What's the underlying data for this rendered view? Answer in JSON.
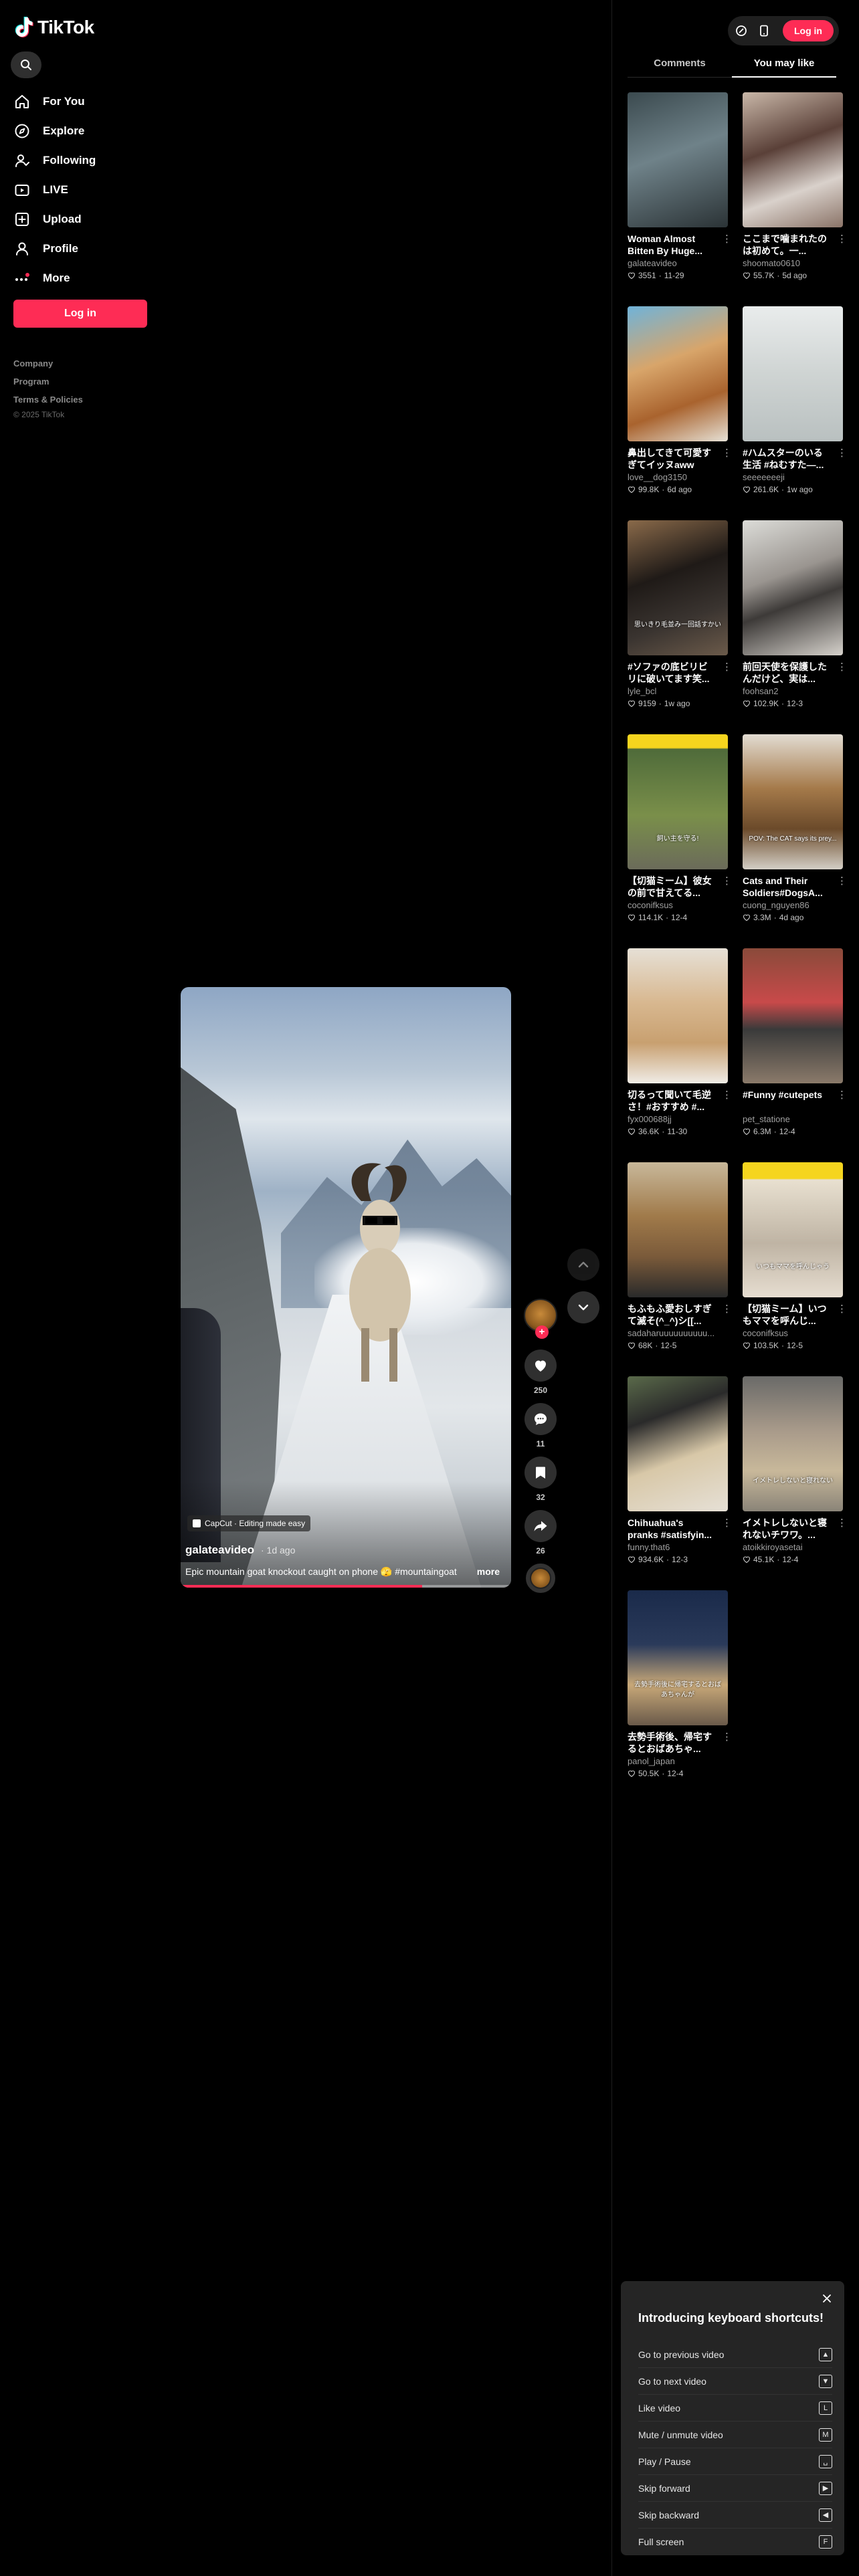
{
  "brand": {
    "name": "TikTok",
    "accent": "#fe2c55"
  },
  "sidebar": {
    "nav": [
      {
        "label": "For You",
        "icon": "home-icon"
      },
      {
        "label": "Explore",
        "icon": "compass-icon"
      },
      {
        "label": "Following",
        "icon": "following-icon"
      },
      {
        "label": "LIVE",
        "icon": "live-icon"
      },
      {
        "label": "Upload",
        "icon": "upload-icon"
      },
      {
        "label": "Profile",
        "icon": "profile-icon"
      },
      {
        "label": "More",
        "icon": "more-icon"
      }
    ],
    "login_label": "Log in",
    "footer": [
      "Company",
      "Program",
      "Terms & Policies"
    ],
    "copyright": "© 2025 TikTok"
  },
  "video": {
    "badge": "CapCut · Editing made easy",
    "author": "galateavideo",
    "posted": "· 1d ago",
    "caption": "Epic mountain goat knockout caught on phone 🫣 #mountaingoat",
    "more_label": "more",
    "progress": 0.73
  },
  "actions": {
    "likes": "250",
    "comments": "11",
    "saves": "32",
    "shares": "26"
  },
  "header": {
    "login_label": "Log in"
  },
  "tabs": [
    {
      "label": "Comments",
      "active": false
    },
    {
      "label": "You may like",
      "active": true
    }
  ],
  "recommended": [
    {
      "title": "Woman Almost Bitten By Huge...",
      "author": "galateavideo",
      "views": "3551",
      "date": "11-29",
      "bg": "linear-gradient(160deg,#3b4a4f,#6f8289 45%,#2b3336)"
    },
    {
      "title": "ここまで噛まれたのは初めて。一...",
      "author": "shoomato0610",
      "views": "55.7K",
      "date": "5d ago",
      "bg": "linear-gradient(160deg,#c9b7a8,#5a4038 40%,#d9d1cb 70%,#8b7468)"
    },
    {
      "title": "鼻出してきて可愛すぎてイッヌaww",
      "author": "love__dog3150",
      "views": "99.8K",
      "date": "6d ago",
      "bg": "linear-gradient(160deg,#6fb3d9,#d8a56a 40%,#a9632e 70%,#e6e1d6)"
    },
    {
      "title": "#ハムスターのいる生活 #ねむすた—...",
      "author": "seeeeeeeji",
      "views": "261.6K",
      "date": "1w ago",
      "bg": "linear-gradient(180deg,#e9ecec,#cfd4d3 50%,#b9c0c0)"
    },
    {
      "title": "#ソファの底ビリビリに破いてます笑...",
      "author": "lyle_bcl",
      "views": "9159",
      "date": "1w ago",
      "overlay": "思いきり毛並み一回話すかい",
      "bg": "linear-gradient(160deg,#8a6a4a,#1f1a17 40%,#3a3430 70%,#6b5a4a)"
    },
    {
      "title": "前回天使を保護したんだけど、実は...",
      "author": "foohsan2",
      "views": "102.9K",
      "date": "12-3",
      "bg": "linear-gradient(160deg,#dcdcd8,#9a9590 40%,#3d3a38 60%,#d6d2cc)"
    },
    {
      "title": "【切猫ミーム】彼女の前で甘えてる...",
      "author": "coconifksus",
      "views": "114.1K",
      "date": "12-4",
      "overlay": "飼い主を守る!",
      "bg": "linear-gradient(180deg,#f5d51e 0%,#f5d51e 10%,#4f6b3a 11%,#7a8f4a 60%,#6b6b5a)"
    },
    {
      "title": "Cats and Their Soldiers#DogsA...",
      "author": "cuong_nguyen86",
      "views": "3.3M",
      "date": "4d ago",
      "overlay": "POV: The CAT says its prey...",
      "bg": "linear-gradient(180deg,#e2dcd2,#a57a4a 40%,#6b4a2a 70%,#d4cfc6)"
    },
    {
      "title": "切るって聞いて毛逆さ！#おすすめ #...",
      "author": "fyx000688jj",
      "views": "36.6K",
      "date": "11-30",
      "bg": "linear-gradient(180deg,#e6e0d6,#d8b890 40%,#c8a070 70%,#f0ece6)"
    },
    {
      "title": "#Funny #cutepets",
      "author": "pet_statione",
      "views": "6.3M",
      "date": "12-4",
      "bg": "linear-gradient(180deg,#8a4a3a,#c84a4a 40%,#3a3a3a 60%,#8a7a6a)"
    },
    {
      "title": "もふもふ愛おしすぎて滅そ(^_^)シ[[...",
      "author": "sadaharuuuuuuuuuu...",
      "views": "68K",
      "date": "12-5",
      "bg": "linear-gradient(180deg,#c8b89a,#a07a4a 40%,#7a5a3a 70%,#2a2a2a)"
    },
    {
      "title": "【切猫ミーム】いつもママを呼んじ...",
      "author": "coconifksus",
      "views": "103.5K",
      "date": "12-5",
      "overlay": "いつもママを呼んじゃう",
      "bg": "linear-gradient(180deg,#f5d51e 0%,#f5d51e 12%,#e8e0d0 13%,#bfb4a4 60%,#e6ddd0)"
    },
    {
      "title": "Chihuahua's pranks #satisfyin...",
      "author": "funny.that6",
      "views": "934.6K",
      "date": "12-3",
      "bg": "linear-gradient(160deg,#5a6a4a,#2a2a2a 30%,#d8c8a8 60%,#e6e0d6)"
    },
    {
      "title": "イメトレしないと寝れないチワワ。...",
      "author": "atoikkiroyasetai",
      "views": "45.1K",
      "date": "12-4",
      "overlay": "イメトレしないと寝れない",
      "bg": "linear-gradient(180deg,#6a6a68,#a89a8a 40%,#c8b89a 70%,#8a8478)"
    },
    {
      "title": "去勢手術後、帰宅するとおばあちゃ...",
      "author": "panol_japan",
      "views": "50.5K",
      "date": "12-4",
      "overlay": "去勢手術後に帰宅するとおばあちゃんが",
      "bg": "linear-gradient(180deg,#1a2a4a,#2a3a5a 40%,#c8a878 70%,#6a5a4a)"
    }
  ],
  "keyboard": {
    "title": "Introducing keyboard shortcuts!",
    "shortcuts": [
      {
        "label": "Go to previous video",
        "key": "▲"
      },
      {
        "label": "Go to next video",
        "key": "▼"
      },
      {
        "label": "Like video",
        "key": "L"
      },
      {
        "label": "Mute / unmute video",
        "key": "M"
      },
      {
        "label": "Play / Pause",
        "key": "␣"
      },
      {
        "label": "Skip forward",
        "key": "▶"
      },
      {
        "label": "Skip backward",
        "key": "◀"
      },
      {
        "label": "Full screen",
        "key": "F"
      }
    ]
  }
}
